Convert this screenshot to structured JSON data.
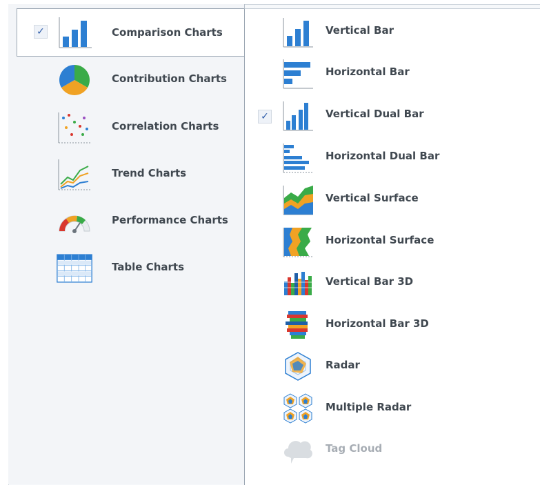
{
  "categories": [
    {
      "label": "Comparison Charts",
      "icon": "bar-chart-icon",
      "selected": true,
      "checked": true
    },
    {
      "label": "Contribution Charts",
      "icon": "pie-chart-icon",
      "selected": false,
      "checked": false
    },
    {
      "label": "Correlation Charts",
      "icon": "scatter-chart-icon",
      "selected": false,
      "checked": false
    },
    {
      "label": "Trend Charts",
      "icon": "line-chart-icon",
      "selected": false,
      "checked": false
    },
    {
      "label": "Performance Charts",
      "icon": "gauge-chart-icon",
      "selected": false,
      "checked": false
    },
    {
      "label": "Table Charts",
      "icon": "table-chart-icon",
      "selected": false,
      "checked": false
    }
  ],
  "chart_types": [
    {
      "label": "Vertical Bar",
      "icon": "vertical-bar-icon",
      "checked": false,
      "enabled": true
    },
    {
      "label": "Horizontal Bar",
      "icon": "horizontal-bar-icon",
      "checked": false,
      "enabled": true
    },
    {
      "label": "Vertical Dual Bar",
      "icon": "vertical-dual-bar-icon",
      "checked": true,
      "enabled": true
    },
    {
      "label": "Horizontal Dual Bar",
      "icon": "horizontal-dual-bar-icon",
      "checked": false,
      "enabled": true
    },
    {
      "label": "Vertical Surface",
      "icon": "vertical-surface-icon",
      "checked": false,
      "enabled": true
    },
    {
      "label": "Horizontal Surface",
      "icon": "horizontal-surface-icon",
      "checked": false,
      "enabled": true
    },
    {
      "label": "Vertical Bar 3D",
      "icon": "vertical-bar-3d-icon",
      "checked": false,
      "enabled": true
    },
    {
      "label": "Horizontal Bar 3D",
      "icon": "horizontal-bar-3d-icon",
      "checked": false,
      "enabled": true
    },
    {
      "label": "Radar",
      "icon": "radar-icon",
      "checked": false,
      "enabled": true
    },
    {
      "label": "Multiple Radar",
      "icon": "multiple-radar-icon",
      "checked": false,
      "enabled": true
    },
    {
      "label": "Tag Cloud",
      "icon": "tag-cloud-icon",
      "checked": false,
      "enabled": false
    }
  ],
  "check_mark": "✓",
  "colors": {
    "blue": "#2d7fd2",
    "green": "#3aab48",
    "orange": "#f0a224",
    "red": "#d9372e",
    "label": "#404850",
    "disabled": "#a7adb4"
  }
}
